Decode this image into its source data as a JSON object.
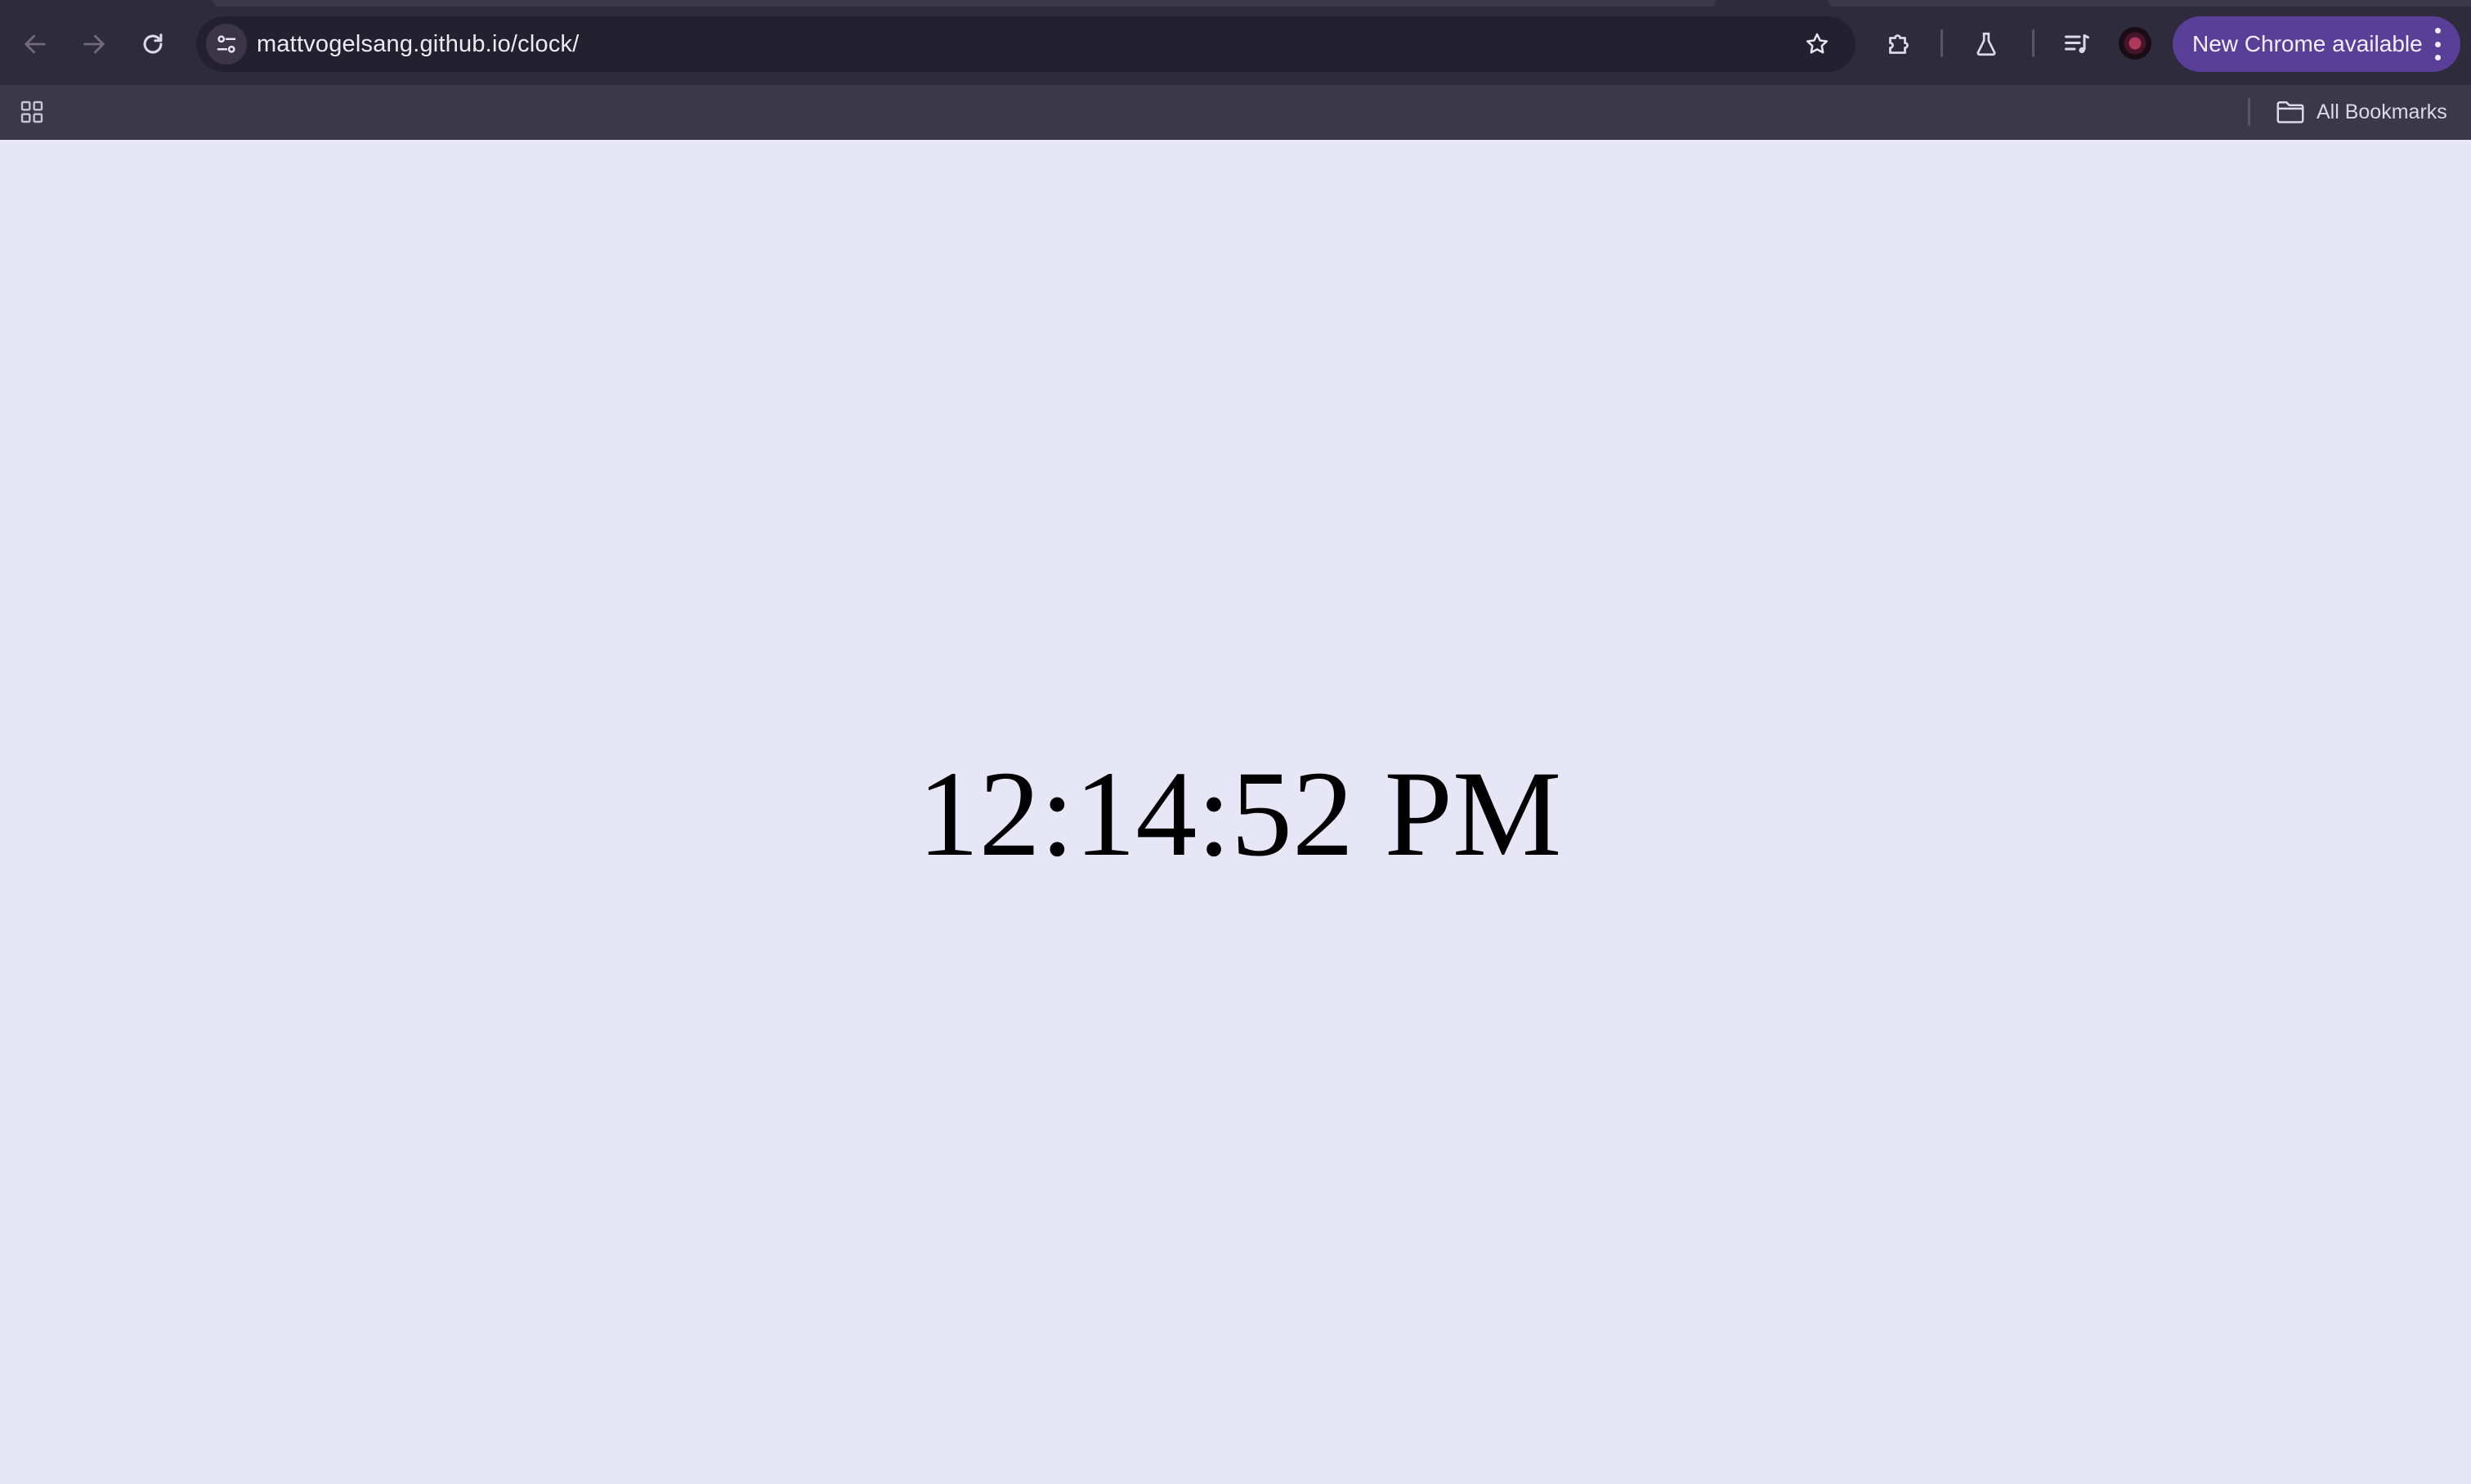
{
  "browser": {
    "address_bar": {
      "url": "mattvogelsang.github.io/clock/"
    },
    "update_button": {
      "label": "New Chrome available"
    },
    "bookmarks_bar": {
      "all_bookmarks_label": "All Bookmarks"
    },
    "icons": {
      "back": "back-arrow-icon",
      "forward": "forward-arrow-icon",
      "reload": "reload-icon",
      "site_info": "tune-icon",
      "bookmark": "star-icon",
      "extensions": "puzzle-icon",
      "labs": "flask-icon",
      "media": "playlist-icon",
      "menu": "kebab-menu-icon",
      "apps": "apps-grid-icon",
      "folder": "folder-icon"
    },
    "colors": {
      "toolbar": "#2e2b3d",
      "omnibox": "#232030",
      "update_button": "#5a3f99",
      "page_background": "#e6e6f7"
    }
  },
  "page": {
    "time_display": "12:14:52 PM"
  }
}
